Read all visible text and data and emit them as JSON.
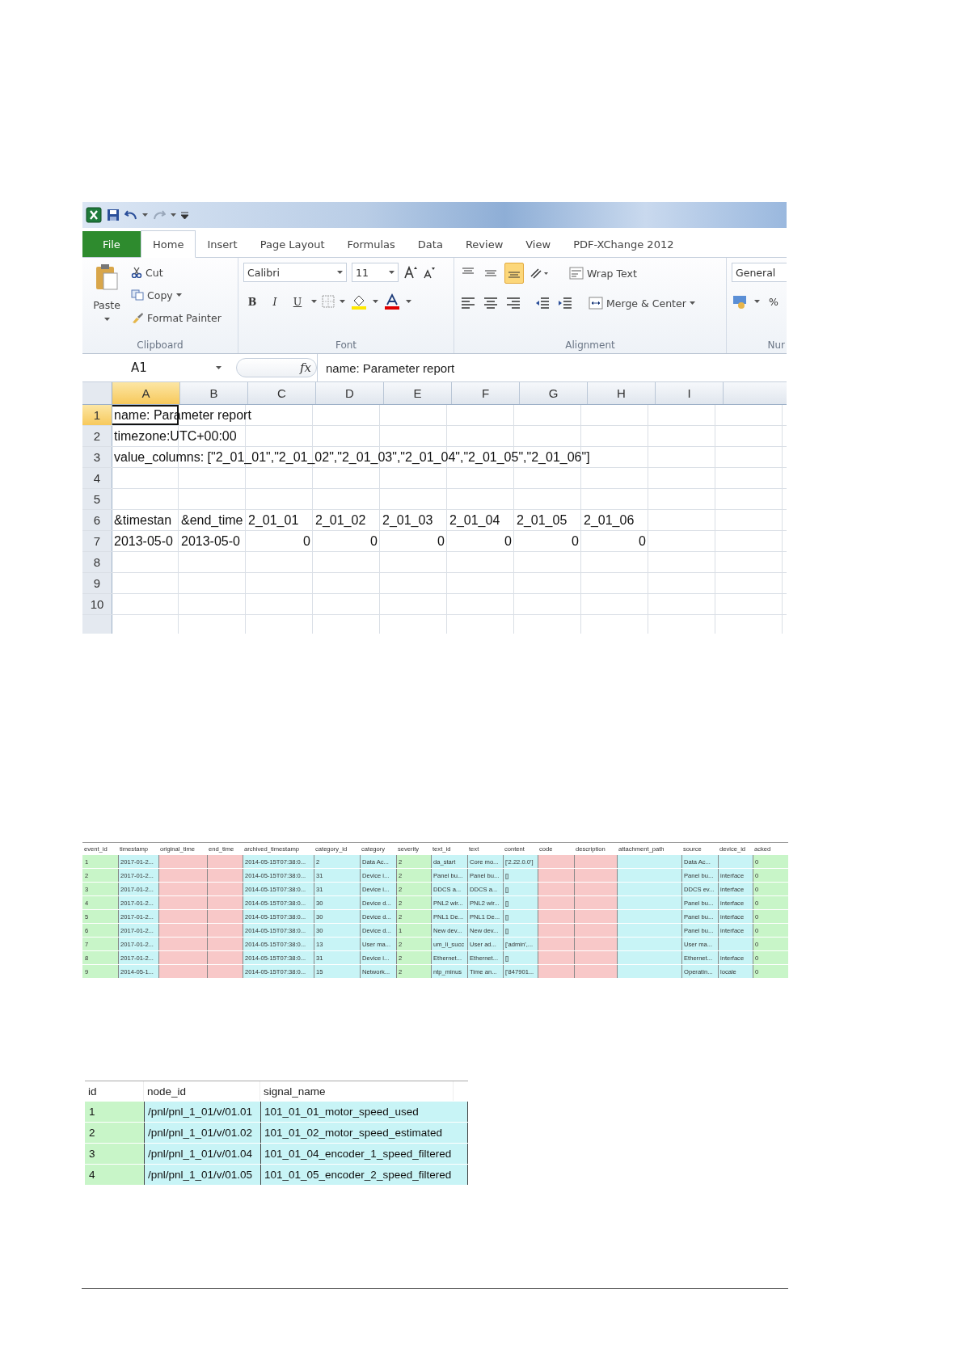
{
  "excel": {
    "tabs": [
      {
        "label": "File",
        "kind": "file",
        "selected": false
      },
      {
        "label": "Home",
        "kind": "tab",
        "selected": true
      },
      {
        "label": "Insert",
        "kind": "tab",
        "selected": false
      },
      {
        "label": "Page Layout",
        "kind": "tab",
        "selected": false
      },
      {
        "label": "Formulas",
        "kind": "tab",
        "selected": false
      },
      {
        "label": "Data",
        "kind": "tab",
        "selected": false
      },
      {
        "label": "Review",
        "kind": "tab",
        "selected": false
      },
      {
        "label": "View",
        "kind": "tab",
        "selected": false
      },
      {
        "label": "PDF-XChange 2012",
        "kind": "tab",
        "selected": false
      }
    ],
    "clipboard": {
      "paste": "Paste",
      "cut": "Cut",
      "copy": "Copy",
      "format_painter": "Format Painter",
      "label": "Clipboard"
    },
    "font": {
      "name": "Calibri",
      "size": "11",
      "bold": "B",
      "italic": "I",
      "underline": "U",
      "label": "Font"
    },
    "alignment": {
      "wrap_text": "Wrap Text",
      "merge_center": "Merge & Center",
      "label": "Alignment",
      "center_aligned": true
    },
    "number": {
      "format": "General",
      "percent": "%",
      "label": "Nur"
    },
    "name_box": "A1",
    "function_label": "fx",
    "formula": "name: Parameter report",
    "columns": [
      {
        "label": "A",
        "selected": true
      },
      {
        "label": "B",
        "selected": false
      },
      {
        "label": "C",
        "selected": false
      },
      {
        "label": "D",
        "selected": false
      },
      {
        "label": "E",
        "selected": false
      },
      {
        "label": "F",
        "selected": false
      },
      {
        "label": "G",
        "selected": false
      },
      {
        "label": "H",
        "selected": false
      },
      {
        "label": "I",
        "selected": false
      }
    ],
    "rows": [
      {
        "header": "1",
        "selected": true,
        "cells": [
          {
            "text": "name: Parameter report",
            "kind": "text"
          }
        ]
      },
      {
        "header": "2",
        "selected": false,
        "cells": [
          {
            "text": "timezone:UTC+00:00",
            "kind": "text"
          }
        ]
      },
      {
        "header": "3",
        "selected": false,
        "cells": [
          {
            "text": "value_columns: [\"2_01_01\",\"2_01_02\",\"2_01_03\",\"2_01_04\",\"2_01_05\",\"2_01_06\"]",
            "kind": "text"
          }
        ]
      },
      {
        "header": "4",
        "selected": false
      },
      {
        "header": "5",
        "selected": false
      },
      {
        "header": "6",
        "selected": false,
        "cells": [
          {
            "text": "&timestan",
            "kind": "text"
          },
          {
            "text": "&end_time",
            "kind": "text"
          },
          {
            "text": "2_01_01",
            "kind": "text"
          },
          {
            "text": "2_01_02",
            "kind": "text"
          },
          {
            "text": "2_01_03",
            "kind": "text"
          },
          {
            "text": "2_01_04",
            "kind": "text"
          },
          {
            "text": "2_01_05",
            "kind": "text"
          },
          {
            "text": "2_01_06",
            "kind": "text"
          }
        ]
      },
      {
        "header": "7",
        "selected": false,
        "cells": [
          {
            "text": "2013-05-0",
            "kind": "text"
          },
          {
            "text": "2013-05-0",
            "kind": "text"
          },
          {
            "text": "0",
            "kind": "number"
          },
          {
            "text": "0",
            "kind": "number"
          },
          {
            "text": "0",
            "kind": "number"
          },
          {
            "text": "0",
            "kind": "number"
          },
          {
            "text": "0",
            "kind": "number"
          },
          {
            "text": "0",
            "kind": "number"
          }
        ]
      },
      {
        "header": "8",
        "selected": false
      },
      {
        "header": "9",
        "selected": false
      },
      {
        "header": "10",
        "selected": false
      }
    ]
  },
  "events_table": {
    "columns": [
      {
        "label": "event_id",
        "color": "#c8f5c8"
      },
      {
        "label": "timestamp",
        "color": "#c8f4f6"
      },
      {
        "label": "original_time",
        "color": "#f8c8c8"
      },
      {
        "label": "end_time",
        "color": "#f8c8c8"
      },
      {
        "label": "archived_timestamp",
        "color": "#c8f4f6"
      },
      {
        "label": "category_id",
        "color": "#c8f4f6"
      },
      {
        "label": "category",
        "color": "#c8f4f6"
      },
      {
        "label": "severity",
        "color": "#c8f5c8"
      },
      {
        "label": "text_id",
        "color": "#c8f4f6"
      },
      {
        "label": "text",
        "color": "#c8f4f6"
      },
      {
        "label": "content",
        "color": "#c8f4f6"
      },
      {
        "label": "code",
        "color": "#f8c8c8"
      },
      {
        "label": "description",
        "color": "#f8c8c8"
      },
      {
        "label": "attachment_path",
        "color": "#c8f4f6"
      },
      {
        "label": "source",
        "color": "#c8f4f6"
      },
      {
        "label": "device_id",
        "color": "#c8f4f6"
      },
      {
        "label": "acked",
        "color": "#c8f5c8"
      }
    ],
    "rows": [
      [
        "1",
        "2017-01-2...",
        null,
        null,
        "2014-05-15T07:38:0...",
        "2",
        "Data Ac...",
        "2",
        "da_start",
        "Core mo...",
        "['2.22.0.0']",
        null,
        null,
        null,
        "Data Ac...",
        null,
        "0"
      ],
      [
        "2",
        "2017-01-2...",
        null,
        null,
        "2014-05-15T07:38:0...",
        "31",
        "Device i...",
        "2",
        "Panel bu...",
        "Panel bu...",
        "[]",
        null,
        null,
        null,
        "Panel bu...",
        "interface",
        "0"
      ],
      [
        "3",
        "2017-01-2...",
        null,
        null,
        "2014-05-15T07:38:0...",
        "31",
        "Device i...",
        "2",
        "DDCS a...",
        "DDCS a...",
        "[]",
        null,
        null,
        null,
        "DDCS ev...",
        "interface",
        "0"
      ],
      [
        "4",
        "2017-01-2...",
        null,
        null,
        "2014-05-15T07:38:0...",
        "30",
        "Device d...",
        "2",
        "PNL2 wir...",
        "PNL2 wir...",
        "[]",
        null,
        null,
        null,
        "Panel bu...",
        "interface",
        "0"
      ],
      [
        "5",
        "2017-01-2...",
        null,
        null,
        "2014-05-15T07:38:0...",
        "30",
        "Device d...",
        "2",
        "PNL1 De...",
        "PNL1 De...",
        "[]",
        null,
        null,
        null,
        "Panel bu...",
        "interface",
        "0"
      ],
      [
        "6",
        "2017-01-2...",
        null,
        null,
        "2014-05-15T07:38:0...",
        "30",
        "Device d...",
        "1",
        "New dev...",
        "New dev...",
        "[]",
        null,
        null,
        null,
        "Panel bu...",
        "interface",
        "0"
      ],
      [
        "7",
        "2017-01-2...",
        null,
        null,
        "2014-05-15T07:38:0...",
        "13",
        "User ma...",
        "2",
        "um_li_succ",
        "User ad...",
        "['admin',...",
        null,
        null,
        null,
        "User ma...",
        null,
        "0"
      ],
      [
        "8",
        "2017-01-2...",
        null,
        null,
        "2014-05-15T07:38:0...",
        "31",
        "Device i...",
        "2",
        "Ethernet...",
        "Ethernet...",
        "[]",
        null,
        null,
        null,
        "Ethernet...",
        "interface",
        "0"
      ],
      [
        "9",
        "2014-05-1...",
        null,
        null,
        "2014-05-15T07:38:0...",
        "15",
        "Network...",
        "2",
        "ntp_minus",
        "Time an...",
        "['847901...",
        null,
        null,
        null,
        "Operatin...",
        "locale",
        "0"
      ]
    ]
  },
  "signals_table": {
    "columns": [
      {
        "label": "id",
        "color": "#c8f5c8"
      },
      {
        "label": "node_id",
        "color": "#c8f4f6"
      },
      {
        "label": "signal_name",
        "color": "#c8f4f6"
      }
    ],
    "rows": [
      [
        "1",
        "/pnl/pnl_1_01/v/01.01",
        "101_01_01_motor_speed_used"
      ],
      [
        "2",
        "/pnl/pnl_1_01/v/01.02",
        "101_01_02_motor_speed_estimated"
      ],
      [
        "3",
        "/pnl/pnl_1_01/v/01.04",
        "101_01_04_encoder_1_speed_filtered"
      ],
      [
        "4",
        "/pnl/pnl_1_01/v/01.05",
        "101_01_05_encoder_2_speed_filtered"
      ]
    ]
  }
}
